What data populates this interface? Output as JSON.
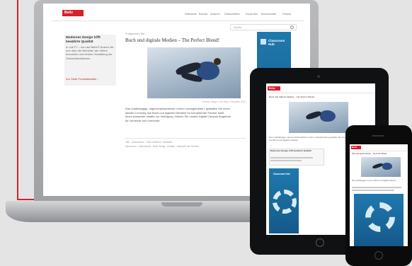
{
  "laptop": {
    "logo": "Beltz",
    "nav": [
      "Startseite",
      "Bücher",
      "Autoren",
      "Zeitschriften",
      "Dozenten",
      "Buchhandel",
      "Presse"
    ],
    "search_placeholder": "Suche",
    "sidebar_title": "Modernes Design trifft bewährte Qualität",
    "sidebar_body": "In Juli FY – neu auf Beltz® Nutzen die nun über die Betreiber der Seiten besuchen und deinen Gestaltung der Onlineinteraktionen",
    "sidebar_link": "Zur Seite Produktdetails ›",
    "kicker": "Fortgesetzt Teil",
    "headline": "Buch und digitale Medien – The Perfect Blend!",
    "caption": "Creative Image, Foto Beltz, Fotografie 2014",
    "body": "Das unabhängige, eigenverantwortliche Lernen vorangetrieben: gestalten Sie einen idealen Lernweg aus Buch und digitalen Medien! Ihr kompetenter Partner stellt Ihnen passende Inhalte zur Verfügung. Nutzen Sie unsere Digital Campus Angebote für Lernende und Lehrende.",
    "meta": "Titel · Lesezeichen · Oben sortieren · Merkliste",
    "footer_links": "Impressum · Datenschutz · Beltz Verlag · Kontakt · Übersicht der Themen",
    "ad_brand": "Classroom Hub"
  },
  "tablet": {
    "logo": "Beltz",
    "headline": "Buch und digitale Medien – The Perfect Blend!",
    "body": "Das unabhängige, eigenverantwortliche Lernen vorangetrieben gestalten Sie einen idealen Lernweg aus Buch und digitalen Medien.",
    "box_title": "Modernes Design trifft bewährte Qualität",
    "ad_brand": "Classroom Hub"
  },
  "phone": {
    "logo": "Beltz",
    "headline": "Buch und digitale Medien – The Perfect Blend!",
    "body": "Das unabhängige Lernen mit Buch und digitalen Medien."
  },
  "colors": {
    "brand_red": "#d81f2a",
    "ad_blue": "#1a6fa3",
    "background": "#e4e4e5"
  }
}
